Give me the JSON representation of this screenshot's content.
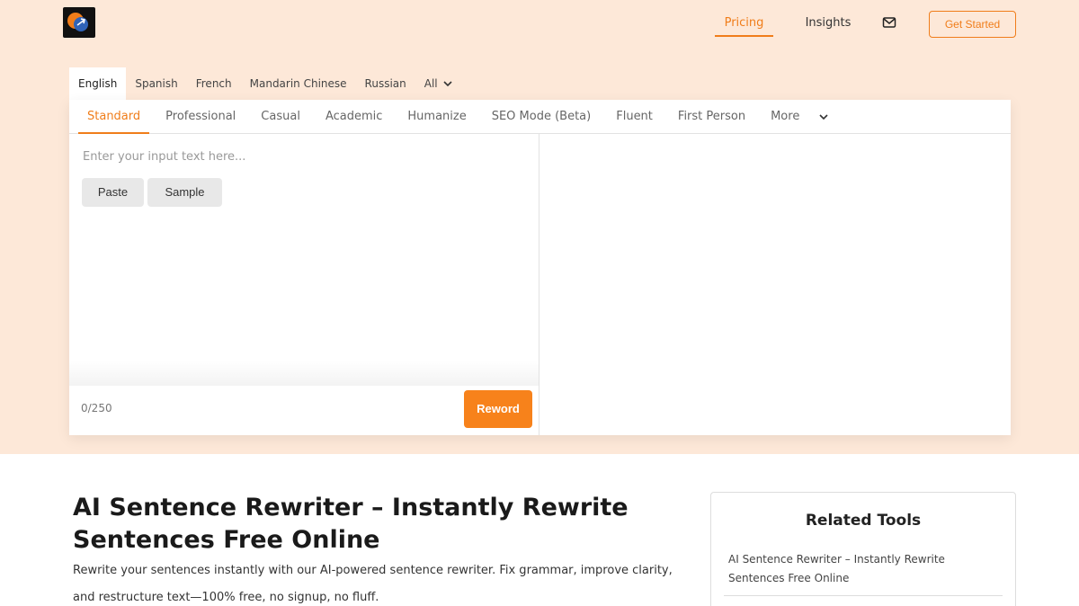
{
  "header": {
    "nav_pricing": "Pricing",
    "nav_insights": "Insights",
    "mail_icon": "mail-icon",
    "cta": "Get Started",
    "accent_color": "#f07d1a"
  },
  "languages": [
    "English",
    "Spanish",
    "French",
    "Mandarin Chinese",
    "Russian"
  ],
  "language_all": "All",
  "modes": [
    "Standard",
    "Professional",
    "Casual",
    "Academic",
    "Humanize",
    "SEO Mode (Beta)",
    "Fluent",
    "First Person"
  ],
  "mode_more": "More",
  "editor": {
    "placeholder": "Enter your input text here...",
    "paste": "Paste",
    "sample": "Sample",
    "counter": "0/250",
    "reword": "Reword"
  },
  "article": {
    "title": "AI Sentence Rewriter – Instantly Rewrite Sentences Free Online",
    "description": "Rewrite your sentences instantly with our AI-powered sentence rewriter. Fix grammar, improve clarity, and restructure text—100% free, no signup, no fluff."
  },
  "related": {
    "title": "Related Tools",
    "items": [
      "AI Sentence Rewriter – Instantly Rewrite Sentences Free Online"
    ]
  }
}
